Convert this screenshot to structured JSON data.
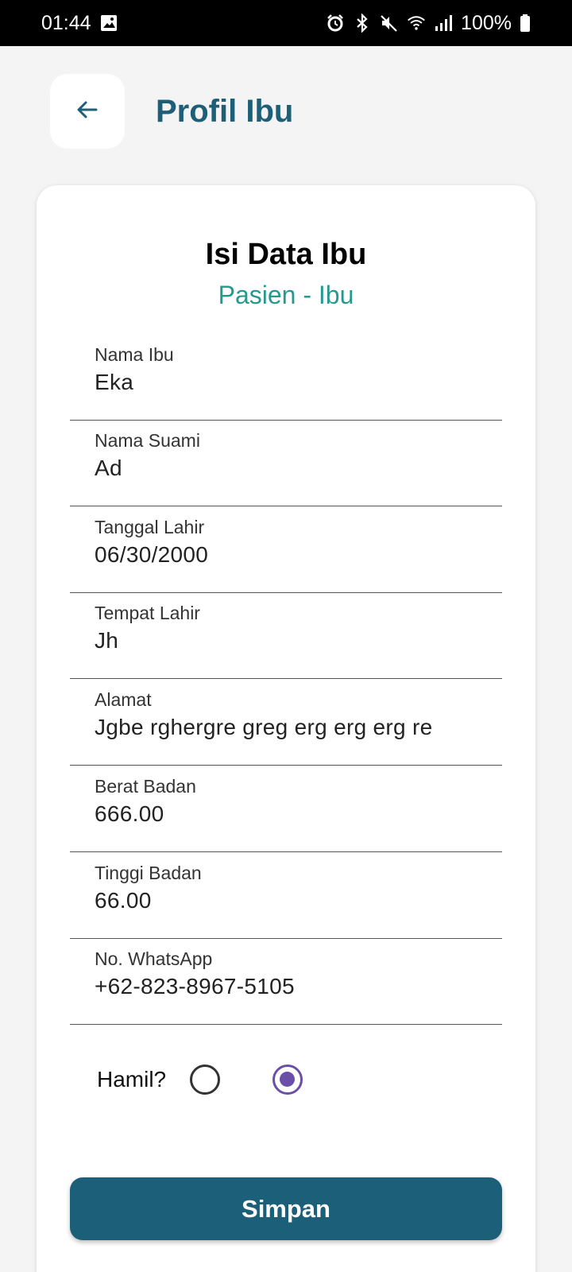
{
  "status_bar": {
    "time": "01:44",
    "battery": "100%"
  },
  "header": {
    "title": "Profil Ibu"
  },
  "card": {
    "title": "Isi Data Ibu",
    "subtitle": "Pasien - Ibu"
  },
  "fields": [
    {
      "label": "Nama Ibu",
      "value": "Eka"
    },
    {
      "label": "Nama Suami",
      "value": "Ad"
    },
    {
      "label": "Tanggal Lahir",
      "value": "06/30/2000"
    },
    {
      "label": "Tempat Lahir",
      "value": "Jh"
    },
    {
      "label": "Alamat",
      "value": "Jgbe rghergre greg erg erg erg re"
    },
    {
      "label": "Berat Badan",
      "value": "666.00"
    },
    {
      "label": "Tinggi Badan",
      "value": "66.00"
    },
    {
      "label": "No. WhatsApp",
      "value": "+62-823-8967-5105"
    }
  ],
  "pregnant": {
    "label": "Hamil?",
    "selected_index": 1
  },
  "save_label": "Simpan",
  "colors": {
    "primary": "#1b5f78",
    "accent_teal": "#26998f",
    "radio_selected": "#6a4fa8"
  }
}
